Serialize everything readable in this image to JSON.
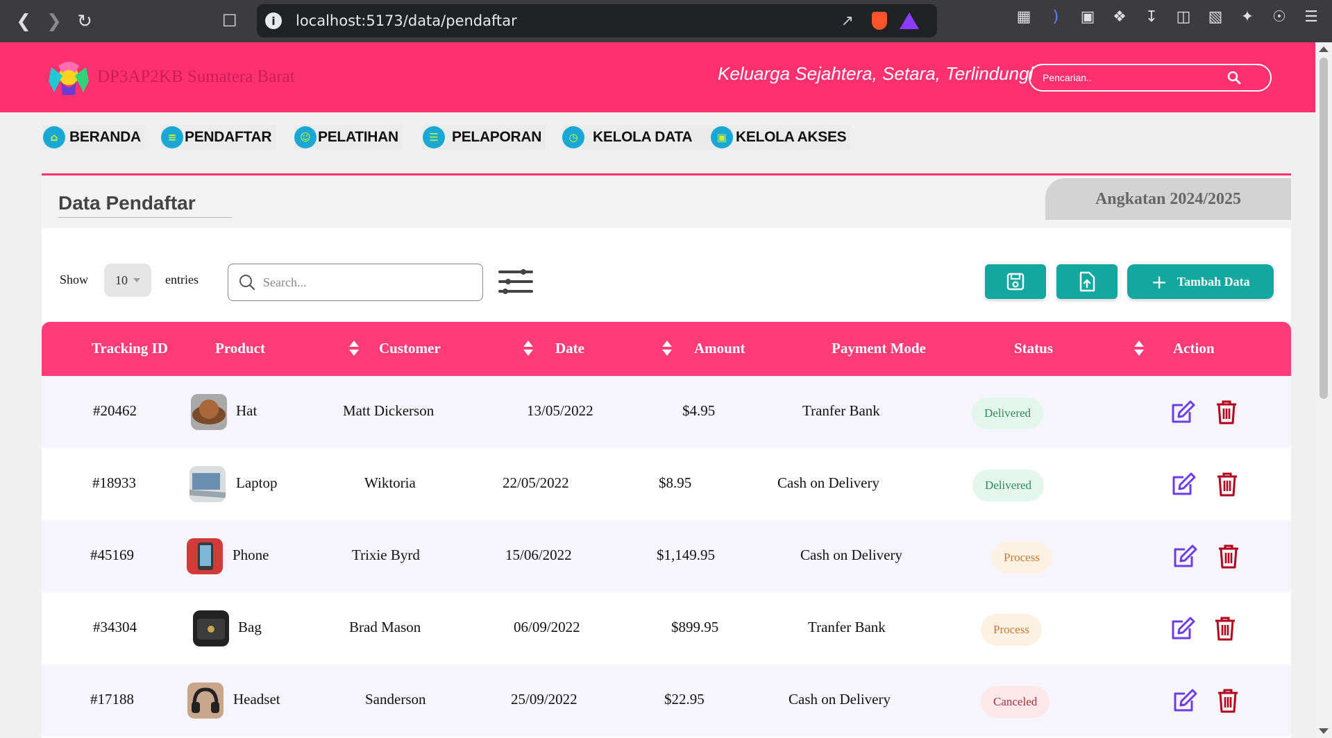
{
  "browser": {
    "url": "localhost:5173/data/pendaftar"
  },
  "header": {
    "site_name": "DP3AP2KB Sumatera Barat",
    "tagline": "Keluarga Sejahtera, Setara, Terlindungi",
    "search_placeholder": "Pencarian..",
    "brand_color": "#ff306e"
  },
  "nav": {
    "items": [
      {
        "label": "BERANDA",
        "icon": "home-icon"
      },
      {
        "label": "PENDAFTAR",
        "icon": "list-icon"
      },
      {
        "label": "PELATIHAN",
        "icon": "user-training-icon"
      },
      {
        "label": "PELAPORAN",
        "icon": "report-icon"
      },
      {
        "label": "KELOLA DATA",
        "icon": "clock-icon"
      },
      {
        "label": "KELOLA AKSES",
        "icon": "access-icon"
      }
    ]
  },
  "page": {
    "title": "Data Pendaftar",
    "angkatan": "Angkatan 2024/2025"
  },
  "controls": {
    "show_label": "Show",
    "entries_value": "10",
    "entries_label": "entries",
    "search_placeholder": "Search...",
    "add_label": "Tambah Data",
    "accent_color": "#12a8a0"
  },
  "table": {
    "columns": [
      "Tracking ID",
      "Product",
      "Customer",
      "Date",
      "Amount",
      "Payment Mode",
      "Status",
      "Action"
    ],
    "rows": [
      {
        "id": "#20462",
        "product": "Hat",
        "customer": "Matt Dickerson",
        "date": "13/05/2022",
        "amount": "$4.95",
        "payment": "Tranfer Bank",
        "status": "Delivered"
      },
      {
        "id": "#18933",
        "product": "Laptop",
        "customer": "Wiktoria",
        "date": "22/05/2022",
        "amount": "$8.95",
        "payment": "Cash on Delivery",
        "status": "Delivered"
      },
      {
        "id": "#45169",
        "product": "Phone",
        "customer": "Trixie Byrd",
        "date": "15/06/2022",
        "amount": "$1,149.95",
        "payment": "Cash on Delivery",
        "status": "Process"
      },
      {
        "id": "#34304",
        "product": "Bag",
        "customer": "Brad Mason",
        "date": "06/09/2022",
        "amount": "$899.95",
        "payment": "Tranfer Bank",
        "status": "Process"
      },
      {
        "id": "#17188",
        "product": "Headset",
        "customer": "Sanderson",
        "date": "25/09/2022",
        "amount": "$22.95",
        "payment": "Cash on Delivery",
        "status": "Canceled"
      }
    ]
  }
}
